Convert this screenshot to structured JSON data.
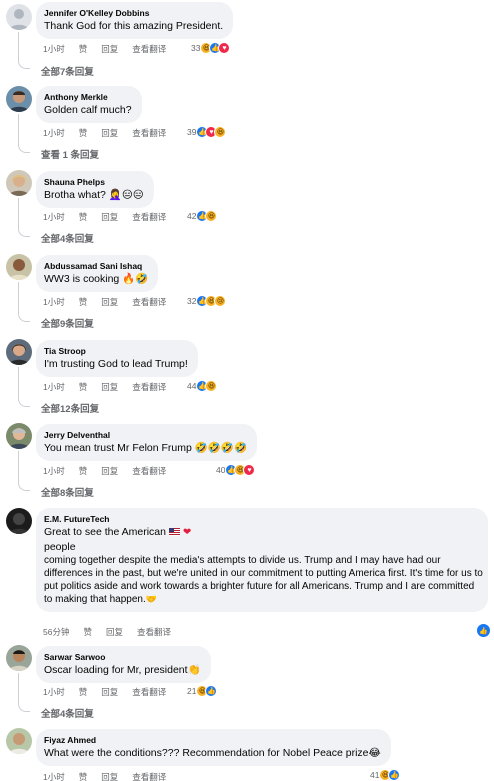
{
  "comments": [
    {
      "author": "Jennifer O'Kelley Dobbins",
      "text": "Thank God for this amazing President.",
      "time": "1小时",
      "like": "赞",
      "reply": "回复",
      "translate": "查看翻译",
      "reaction_count": "33",
      "reactions": [
        "haha-icon",
        "like-icon",
        "love-icon"
      ],
      "replies_link": "全部7条回复"
    },
    {
      "author": "Anthony Merkle",
      "text": "Golden calf much?",
      "time": "1小时",
      "like": "赞",
      "reply": "回复",
      "translate": "查看翻译",
      "reaction_count": "39",
      "reactions": [
        "like-icon",
        "love-icon",
        "haha-icon"
      ],
      "replies_link": "查看 1 条回复"
    },
    {
      "author": "Shauna Phelps",
      "text": "Brotha what? 🤦‍♀️😑😑",
      "time": "1小时",
      "like": "赞",
      "reply": "回复",
      "translate": "查看翻译",
      "reaction_count": "42",
      "reactions": [
        "like-icon",
        "haha-icon"
      ],
      "replies_link": "全部4条回复"
    },
    {
      "author": "Abdussamad Sani Ishaq",
      "text": "WW3 is cooking 🔥🤣",
      "time": "1小时",
      "like": "赞",
      "reply": "回复",
      "translate": "查看翻译",
      "reaction_count": "32",
      "reactions": [
        "like-icon",
        "haha-icon",
        "sad-icon"
      ],
      "replies_link": "全部9条回复"
    },
    {
      "author": "Tia Stroop",
      "text": "I'm trusting God to lead Trump!",
      "time": "1小时",
      "like": "赞",
      "reply": "回复",
      "translate": "查看翻译",
      "reaction_count": "44",
      "reactions": [
        "like-icon",
        "haha-icon"
      ],
      "replies_link": "全部12条回复"
    },
    {
      "author": "Jerry Delventhal",
      "text": "You mean trust Mr Felon Frump 🤣🤣🤣🤣",
      "time": "1小时",
      "like": "赞",
      "reply": "回复",
      "translate": "查看翻译",
      "reaction_count": "40",
      "reactions": [
        "like-icon",
        "haha-icon",
        "love-icon"
      ],
      "replies_link": "全部8条回复"
    },
    {
      "author": "E.M. FutureTech",
      "text_line1": "Great to see the American",
      "text_line2": "people",
      "text_body": "coming together despite the media's attempts to divide us. Trump and I may have had our differences in the past, but we're united in our commitment to putting America first. It's time for us to put politics aside and work towards a brighter future for all Americans. Trump and I are committed to making that happen.",
      "time": "56分钟",
      "like": "赞",
      "reply": "回复",
      "translate": "查看翻译",
      "reactions": [
        "like-icon"
      ]
    },
    {
      "author": "Sarwar Sarwoo",
      "text": "Oscar loading for Mr, president👏",
      "time": "1小时",
      "like": "赞",
      "reply": "回复",
      "translate": "查看翻译",
      "reaction_count": "21",
      "reactions": [
        "haha-icon",
        "like-icon"
      ],
      "replies_link": "全部4条回复"
    },
    {
      "author": "Fiyaz Ahmed",
      "text": "What were the conditions??? Recommendation for Nobel Peace prize😂",
      "time": "1小时",
      "like": "赞",
      "reply": "回复",
      "translate": "查看翻译",
      "reaction_count": "41"
    }
  ]
}
